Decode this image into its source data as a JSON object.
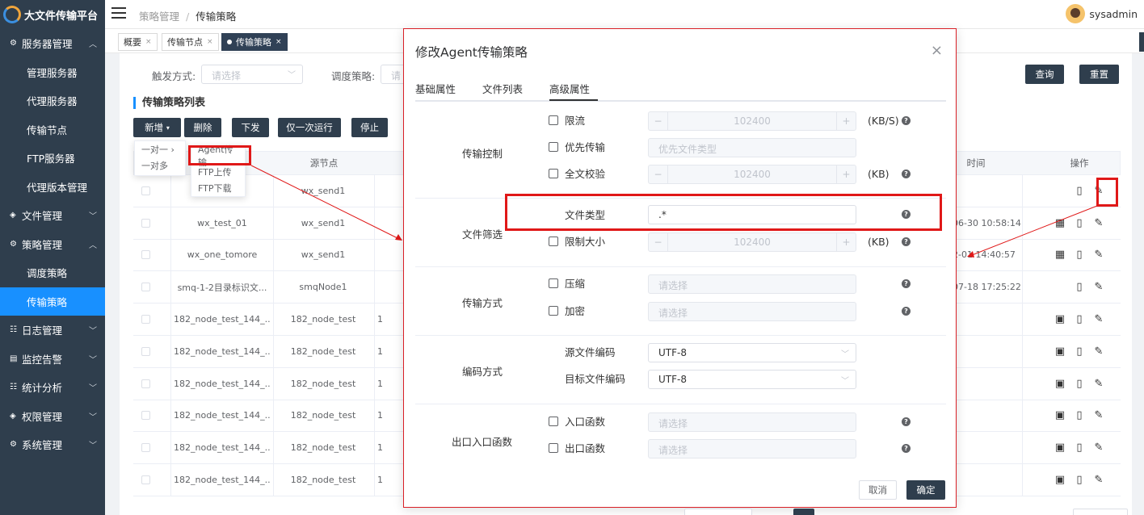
{
  "app": {
    "name": "大文件传输平台",
    "user": "sysadmin"
  },
  "breadcrumb": {
    "parent": "策略管理",
    "current": "传输策略"
  },
  "sidebar": {
    "items": [
      {
        "label": "服务器管理",
        "icon": "server-icon",
        "expanded": true
      },
      {
        "label": "管理服务器"
      },
      {
        "label": "代理服务器"
      },
      {
        "label": "传输节点"
      },
      {
        "label": "FTP服务器"
      },
      {
        "label": "代理版本管理"
      },
      {
        "label": "文件管理",
        "icon": "file-icon"
      },
      {
        "label": "策略管理",
        "icon": "policy-icon",
        "expanded": true
      },
      {
        "label": "调度策略"
      },
      {
        "label": "传输策略",
        "active": true
      },
      {
        "label": "日志管理",
        "icon": "log-icon"
      },
      {
        "label": "监控告警",
        "icon": "monitor-icon"
      },
      {
        "label": "统计分析",
        "icon": "stats-icon"
      },
      {
        "label": "权限管理",
        "icon": "permission-icon"
      },
      {
        "label": "系统管理",
        "icon": "settings-icon"
      }
    ]
  },
  "tabs": [
    {
      "label": "概要"
    },
    {
      "label": "传输节点"
    },
    {
      "label": "传输策略",
      "active": true
    }
  ],
  "filters": {
    "trigger_label": "触发方式:",
    "trigger_placeholder": "请选择",
    "schedule_label": "调度策略:",
    "schedule_placeholder": "请",
    "query_btn": "查询",
    "reset_btn": "重置"
  },
  "list": {
    "title": "传输策略列表",
    "buttons": {
      "add": "新增",
      "delete": "删除",
      "dispatch": "下发",
      "run_once": "仅一次运行",
      "stop": "停止"
    },
    "add_menu": [
      "一对一",
      "一对多"
    ],
    "add_submenu": [
      "Agent传输",
      "FTP上传",
      "FTP下载"
    ],
    "columns": {
      "name": "",
      "source": "源节点",
      "time": "时间",
      "ops": "操作"
    },
    "rows": [
      {
        "name": "",
        "source": "wx_send1",
        "col3": "",
        "time": ""
      },
      {
        "name": "wx_test_01",
        "source": "wx_send1",
        "col3": "",
        "time": "06-30 10:58:14"
      },
      {
        "name": "wx_one_tomore",
        "source": "wx_send1",
        "col3": "",
        "time": "2-01 14:40:57"
      },
      {
        "name": "smq-1-2目录标识文...",
        "source": "smqNode1",
        "col3": "",
        "time": "07-18 17:25:22"
      },
      {
        "name": "182_node_test_144_...",
        "source": "182_node_test",
        "col3": "1",
        "time": ""
      },
      {
        "name": "182_node_test_144_...",
        "source": "182_node_test",
        "col3": "1",
        "time": ""
      },
      {
        "name": "182_node_test_144_...",
        "source": "182_node_test",
        "col3": "1",
        "time": ""
      },
      {
        "name": "182_node_test_144_...",
        "source": "182_node_test",
        "col3": "1",
        "time": ""
      },
      {
        "name": "182_node_test_144_...",
        "source": "182_node_test",
        "col3": "1",
        "time": ""
      },
      {
        "name": "182_node_test_144_...",
        "source": "182_node_test",
        "col3": "1",
        "time": ""
      }
    ]
  },
  "modal": {
    "title": "修改Agent传输策略",
    "tabs": [
      "基础属性",
      "文件列表",
      "高级属性"
    ],
    "active_tab": "高级属性",
    "groups": {
      "transfer_control": {
        "label": "传输控制",
        "rate_limit": {
          "label": "限流",
          "value": "102400",
          "unit": "(KB/S)"
        },
        "priority": {
          "label": "优先传输",
          "placeholder": "优先文件类型"
        },
        "checksum": {
          "label": "全文校验",
          "value": "102400",
          "unit": "(KB)"
        }
      },
      "file_filter": {
        "label": "文件筛选",
        "file_type": {
          "label": "文件类型",
          "value": ".*"
        },
        "size_limit": {
          "label": "限制大小",
          "value": "102400",
          "unit": "(KB)"
        }
      },
      "transfer_mode": {
        "label": "传输方式",
        "compress": {
          "label": "压缩",
          "placeholder": "请选择"
        },
        "encrypt": {
          "label": "加密",
          "placeholder": "请选择"
        }
      },
      "encoding": {
        "label": "编码方式",
        "source": {
          "label": "源文件编码",
          "value": "UTF-8"
        },
        "target": {
          "label": "目标文件编码",
          "value": "UTF-8"
        }
      },
      "io_functions": {
        "label": "出口入口函数",
        "entry": {
          "label": "入口函数",
          "placeholder": "请选择"
        },
        "exit": {
          "label": "出口函数",
          "placeholder": "请选择"
        }
      }
    },
    "footer": {
      "cancel": "取消",
      "confirm": "确定"
    }
  },
  "colors": {
    "sidebar_bg": "#2f3e4d",
    "accent": "#1890ff",
    "highlight": "#e01818"
  }
}
